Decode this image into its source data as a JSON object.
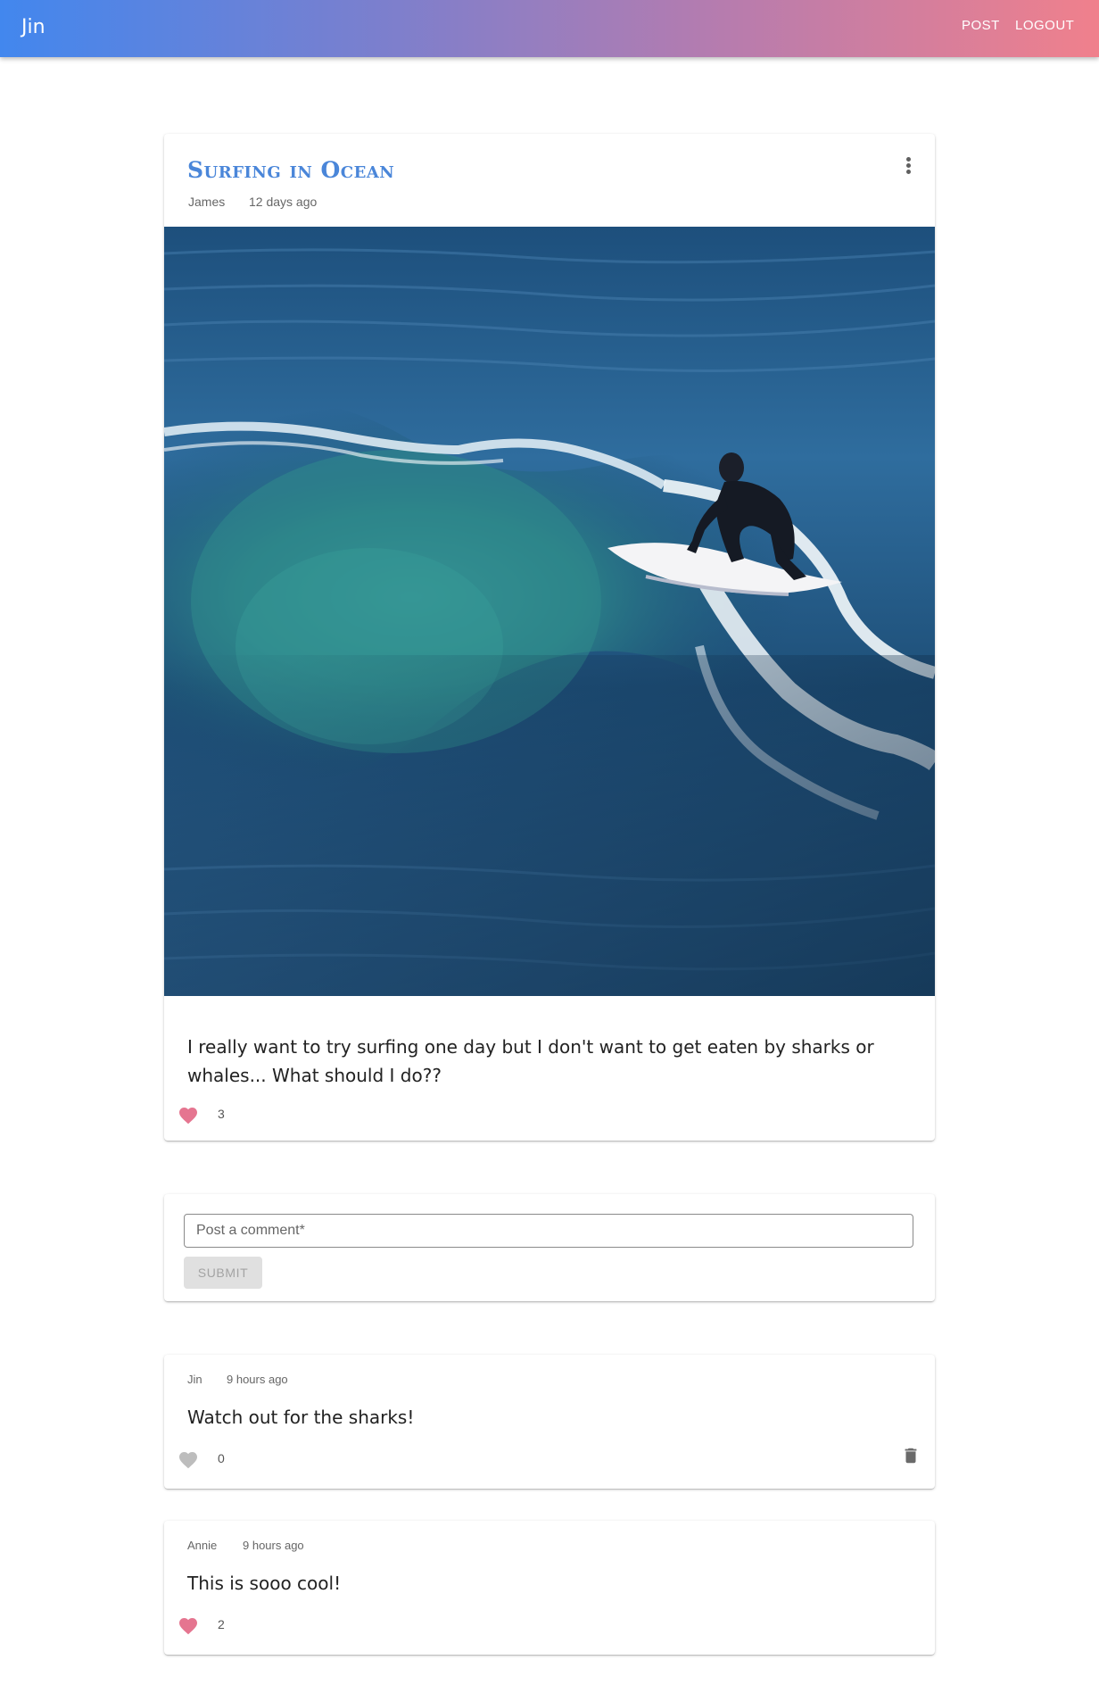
{
  "app": {
    "brand": "Jin",
    "nav": {
      "post_label": "POST",
      "logout_label": "LOGOUT"
    }
  },
  "post": {
    "title": "Surfing in Ocean",
    "author": "James",
    "time": "12 days ago",
    "body": "I really want to try surfing one day but I don't want to get eaten by sharks or whales... What should I do??",
    "likes": "3",
    "liked": true,
    "image_subject": "surfer riding a wave in the ocean"
  },
  "comment_form": {
    "placeholder": "Post a comment",
    "required_mark": "*",
    "submit_label": "SUBMIT"
  },
  "comments": [
    {
      "author": "Jin",
      "time": "9 hours ago",
      "body": "Watch out for the sharks!",
      "likes": "0",
      "liked": false,
      "deletable": true
    },
    {
      "author": "Annie",
      "time": "9 hours ago",
      "body": "This is sooo cool!",
      "likes": "2",
      "liked": true,
      "deletable": false
    }
  ],
  "colors": {
    "heart_liked": "#e57590",
    "heart_unliked": "#bdbdbd",
    "title": "#4a86d9"
  }
}
